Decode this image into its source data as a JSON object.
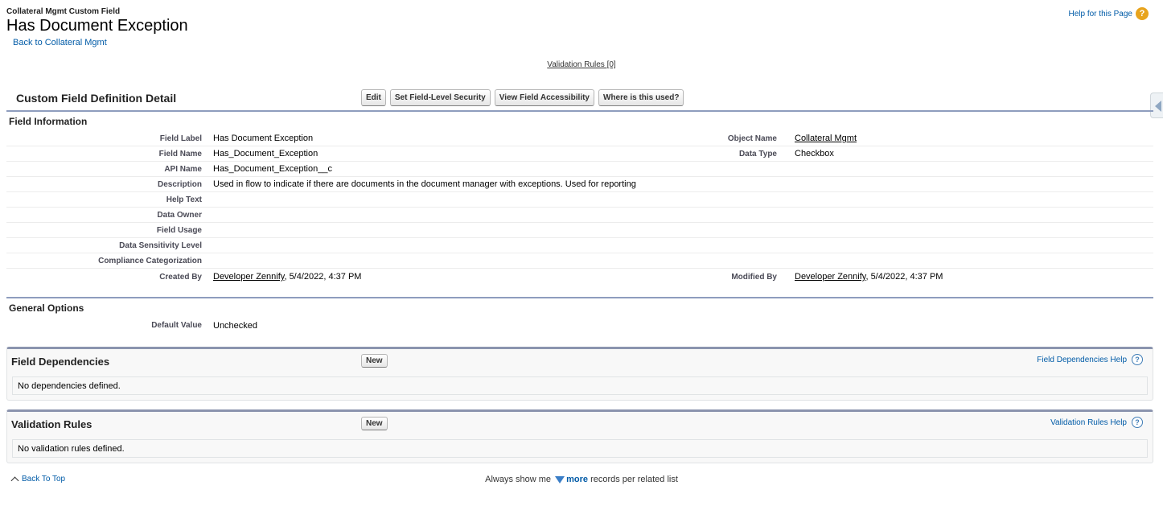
{
  "header": {
    "object_type": "Collateral Mgmt Custom Field",
    "title": "Has Document Exception",
    "back_link": "Back to Collateral Mgmt",
    "help_link": "Help for this Page"
  },
  "validation_rules_link": "Validation Rules [0]",
  "detail": {
    "title": "Custom Field Definition Detail",
    "buttons": {
      "edit": "Edit",
      "fls": "Set Field-Level Security",
      "access": "View Field Accessibility",
      "where_used": "Where is this used?"
    },
    "field_information": {
      "title": "Field Information",
      "field_label": {
        "label": "Field Label",
        "value": "Has Document Exception"
      },
      "object_name": {
        "label": "Object Name",
        "value": "Collateral Mgmt"
      },
      "field_name": {
        "label": "Field Name",
        "value": "Has_Document_Exception"
      },
      "data_type": {
        "label": "Data Type",
        "value": "Checkbox"
      },
      "api_name": {
        "label": "API Name",
        "value": "Has_Document_Exception__c"
      },
      "description": {
        "label": "Description",
        "value": "Used in flow to indicate if there are documents in the document manager with exceptions. Used for reporting"
      },
      "help_text": {
        "label": "Help Text",
        "value": ""
      },
      "data_owner": {
        "label": "Data Owner",
        "value": ""
      },
      "field_usage": {
        "label": "Field Usage",
        "value": ""
      },
      "data_sensitivity": {
        "label": "Data Sensitivity Level",
        "value": ""
      },
      "compliance": {
        "label": "Compliance Categorization",
        "value": ""
      },
      "created_by": {
        "label": "Created By",
        "user": "Developer Zennify",
        "date": ", 5/4/2022, 4:37 PM"
      },
      "modified_by": {
        "label": "Modified By",
        "user": "Developer Zennify",
        "date": ", 5/4/2022, 4:37 PM"
      }
    },
    "general_options": {
      "title": "General Options",
      "default_value": {
        "label": "Default Value",
        "value": "Unchecked"
      }
    }
  },
  "field_dependencies": {
    "title": "Field Dependencies",
    "new_button": "New",
    "help": "Field Dependencies Help",
    "empty": "No dependencies defined."
  },
  "validation_rules": {
    "title": "Validation Rules",
    "new_button": "New",
    "help": "Validation Rules Help",
    "empty": "No validation rules defined."
  },
  "footer": {
    "back_to_top": "Back To Top",
    "always_prefix": "Always show me",
    "more": "more",
    "always_suffix": "records per related list"
  },
  "icons": {
    "help_orange": "?",
    "help_blue": "?"
  },
  "colors": {
    "link": "#015ba7",
    "section_rule": "#8e9dbe",
    "help_orange": "#e8a41d"
  }
}
